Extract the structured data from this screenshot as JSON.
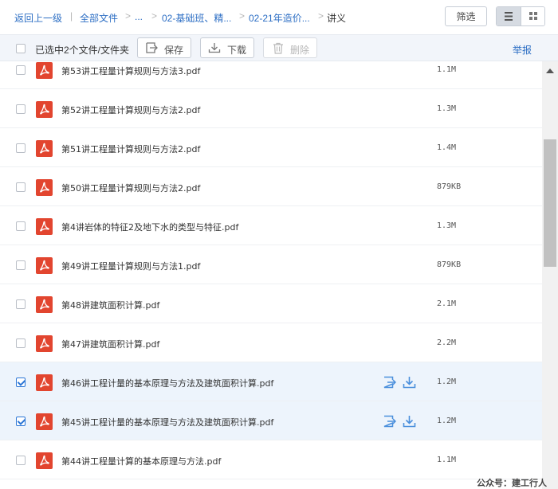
{
  "breadcrumb": {
    "back": "返回上一级",
    "root": "全部文件",
    "ellipsis": "...",
    "level1": "02-基础班、精...",
    "level2": "02-21年造价...",
    "current": "讲义"
  },
  "header": {
    "filter_label": "筛选",
    "view_mode": "list"
  },
  "toolbar": {
    "selected_text": "已选中2个文件/文件夹",
    "save_label": "保存",
    "download_label": "下载",
    "delete_label": "删除",
    "report_label": "举报"
  },
  "files": [
    {
      "name": "第53讲工程量计算规则与方法3.pdf",
      "size": "1.1M",
      "checked": false
    },
    {
      "name": "第52讲工程量计算规则与方法2.pdf",
      "size": "1.3M",
      "checked": false
    },
    {
      "name": "第51讲工程量计算规则与方法2.pdf",
      "size": "1.4M",
      "checked": false
    },
    {
      "name": "第50讲工程量计算规则与方法2.pdf",
      "size": "879KB",
      "checked": false
    },
    {
      "name": "第4讲岩体的特征2及地下水的类型与特征.pdf",
      "size": "1.3M",
      "checked": false
    },
    {
      "name": "第49讲工程量计算规则与方法1.pdf",
      "size": "879KB",
      "checked": false
    },
    {
      "name": "第48讲建筑面积计算.pdf",
      "size": "2.1M",
      "checked": false
    },
    {
      "name": "第47讲建筑面积计算.pdf",
      "size": "2.2M",
      "checked": false
    },
    {
      "name": "第46讲工程计量的基本原理与方法及建筑面积计算.pdf",
      "size": "1.2M",
      "checked": true
    },
    {
      "name": "第45讲工程计量的基本原理与方法及建筑面积计算.pdf",
      "size": "1.2M",
      "checked": true
    },
    {
      "name": "第44讲工程量计算的基本原理与方法.pdf",
      "size": "1.1M",
      "checked": false
    }
  ],
  "icons": {
    "file_icon": "pdf-icon",
    "row_actions": [
      "save-to-drive-icon",
      "download-icon"
    ]
  },
  "colors": {
    "link": "#2c6ec4",
    "pdf_red": "#e2452f",
    "selected_row": "#edf4fc"
  },
  "watermark": "公众号：建工行人"
}
